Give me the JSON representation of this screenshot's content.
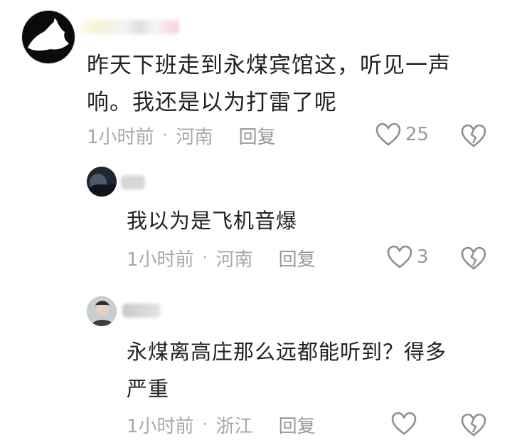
{
  "comments": [
    {
      "text": "昨天下班走到永煤宾馆这，听见一声响。我还是以为打雷了呢",
      "line1": "昨天下班走到永煤宾馆这，听见一声",
      "line2": "响。我还是以为打雷了呢",
      "time": "1小时前",
      "location": "河南",
      "reply_label": "回复",
      "likes": "25"
    },
    {
      "text": "我以为是飞机音爆",
      "time": "1小时前",
      "location": "河南",
      "reply_label": "回复",
      "likes": "3"
    },
    {
      "text": "永煤离高庄那么远都能听到？得多严重",
      "line1": "永煤离高庄那么远都能听到？得多",
      "line2": "严重",
      "time": "1小时前",
      "location": "浙江",
      "reply_label": "回复",
      "likes": ""
    }
  ],
  "separator": "·",
  "colors": {
    "text": "#222222",
    "meta": "#a8a8a8",
    "icon": "#8f8f8f",
    "background": "#ffffff"
  },
  "icons": [
    "heart-icon",
    "dislike-heart-icon"
  ]
}
